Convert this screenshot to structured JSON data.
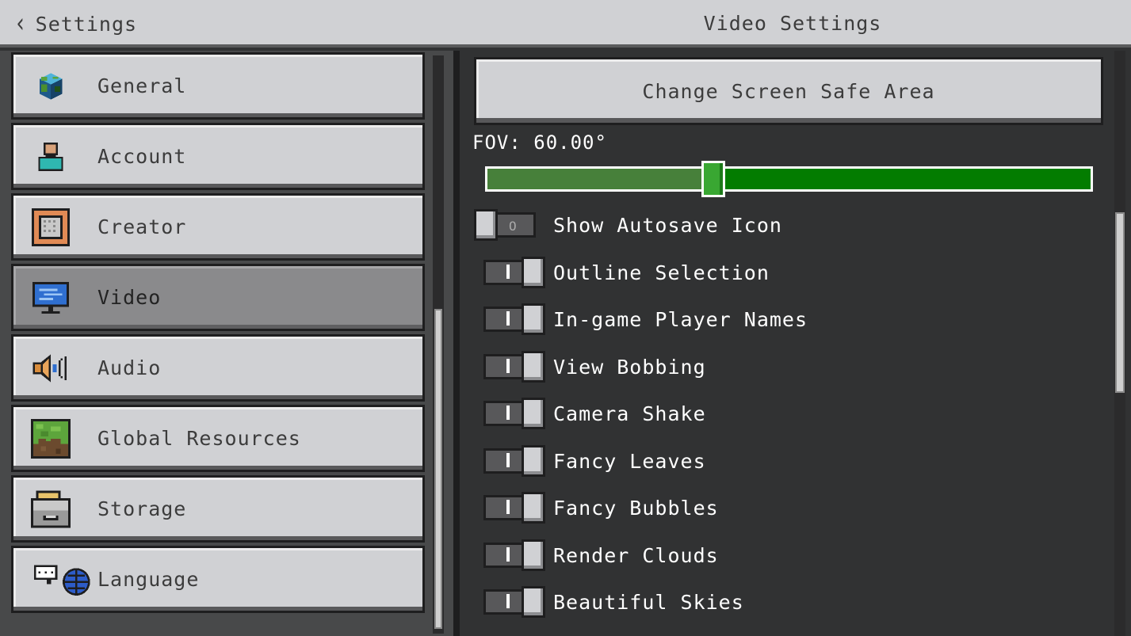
{
  "header": {
    "back_label": "Settings",
    "title": "Video Settings"
  },
  "sidebar": {
    "items": [
      {
        "label": "General",
        "icon": "globe-icon",
        "active": false
      },
      {
        "label": "Account",
        "icon": "account-icon",
        "active": false
      },
      {
        "label": "Creator",
        "icon": "command-block-icon",
        "active": false
      },
      {
        "label": "Video",
        "icon": "monitor-icon",
        "active": true
      },
      {
        "label": "Audio",
        "icon": "speaker-icon",
        "active": false
      },
      {
        "label": "Global Resources",
        "icon": "grass-block-icon",
        "active": false
      },
      {
        "label": "Storage",
        "icon": "storage-drawer-icon",
        "active": false
      },
      {
        "label": "Language",
        "icon": "language-globe-icon",
        "active": false
      }
    ]
  },
  "panel": {
    "safe_area_button": "Change Screen Safe Area",
    "fov": {
      "label": "FOV: 60.00°",
      "value": 60,
      "min": 30,
      "max": 110
    },
    "toggles": [
      {
        "label": "Show Autosave Icon",
        "on": false
      },
      {
        "label": "Outline Selection",
        "on": true
      },
      {
        "label": "In-game Player Names",
        "on": true
      },
      {
        "label": "View Bobbing",
        "on": true
      },
      {
        "label": "Camera Shake",
        "on": true
      },
      {
        "label": "Fancy Leaves",
        "on": true
      },
      {
        "label": "Fancy Bubbles",
        "on": true
      },
      {
        "label": "Render Clouds",
        "on": true
      },
      {
        "label": "Beautiful Skies",
        "on": true
      }
    ]
  },
  "colors": {
    "header_bg": "#d0d1d4",
    "panel_bg": "#313233",
    "slider_fill": "#47803a",
    "slider_rest": "#037c00",
    "slider_thumb": "#39a732"
  }
}
